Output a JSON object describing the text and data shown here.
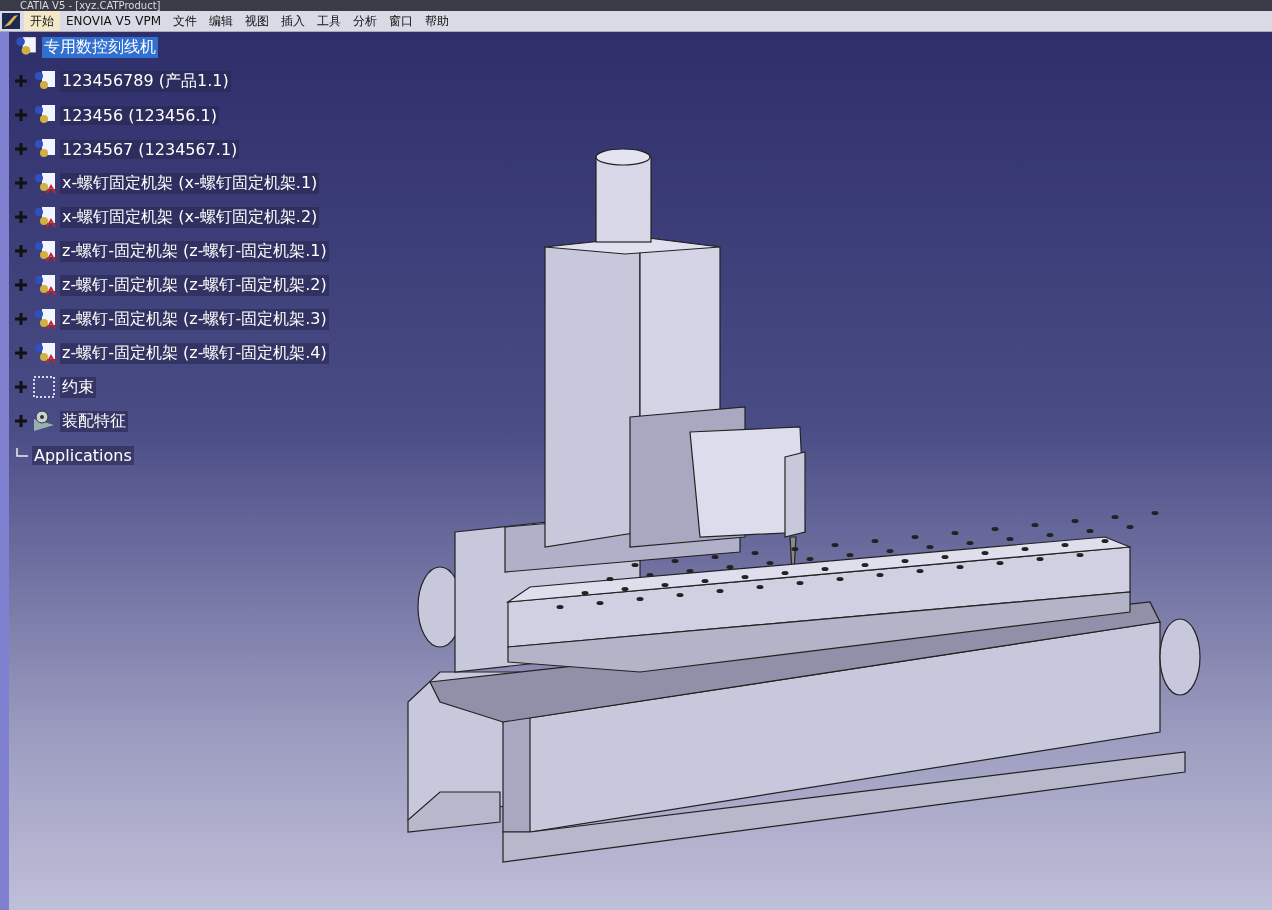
{
  "window": {
    "title": "CATIA V5 - [xyz.CATProduct]"
  },
  "menu_bar": {
    "items": [
      {
        "label": "开始",
        "selected": true
      },
      {
        "label": "ENOVIA V5 VPM",
        "selected": false
      },
      {
        "label": "文件",
        "selected": false
      },
      {
        "label": "编辑",
        "selected": false
      },
      {
        "label": "视图",
        "selected": false
      },
      {
        "label": "插入",
        "selected": false
      },
      {
        "label": "工具",
        "selected": false
      },
      {
        "label": "分析",
        "selected": false
      },
      {
        "label": "窗口",
        "selected": false
      },
      {
        "label": "帮助",
        "selected": false
      }
    ]
  },
  "tree": {
    "root": {
      "label": "专用数控刻线机",
      "selected": true
    },
    "children": [
      {
        "kind": "product",
        "label": "123456789 (产品1.1)",
        "expanded": false
      },
      {
        "kind": "product",
        "label": "123456 (123456.1)",
        "expanded": false
      },
      {
        "kind": "product",
        "label": "1234567 (1234567.1)",
        "expanded": false
      },
      {
        "kind": "part",
        "label": "x-螺钉固定机架 (x-螺钉固定机架.1)",
        "expanded": false
      },
      {
        "kind": "part",
        "label": "x-螺钉固定机架 (x-螺钉固定机架.2)",
        "expanded": false
      },
      {
        "kind": "part",
        "label": "z-螺钉-固定机架 (z-螺钉-固定机架.1)",
        "expanded": false
      },
      {
        "kind": "part",
        "label": "z-螺钉-固定机架 (z-螺钉-固定机架.2)",
        "expanded": false
      },
      {
        "kind": "part",
        "label": "z-螺钉-固定机架 (z-螺钉-固定机架.3)",
        "expanded": false
      },
      {
        "kind": "part",
        "label": "z-螺钉-固定机架 (z-螺钉-固定机架.4)",
        "expanded": false
      },
      {
        "kind": "constraints",
        "label": "约束",
        "expanded": false
      },
      {
        "kind": "features",
        "label": "装配特征",
        "expanded": false
      },
      {
        "kind": "applications",
        "label": "Applications"
      }
    ]
  }
}
